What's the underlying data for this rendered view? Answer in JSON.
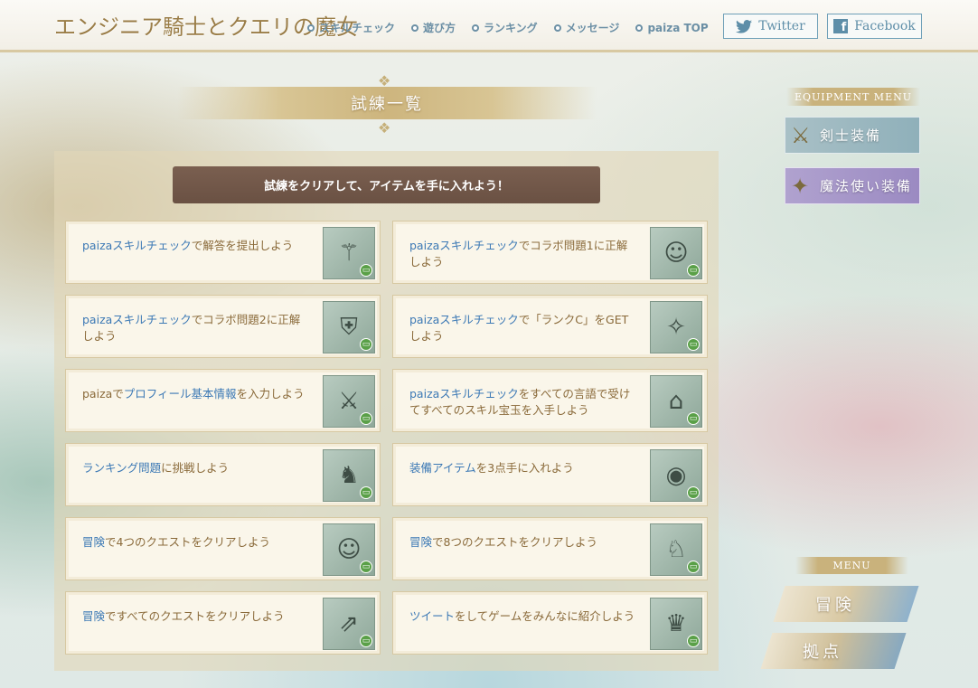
{
  "header": {
    "logo": "エンジニア騎士とクエリの魔女",
    "nav": [
      "スキルチェック",
      "遊び方",
      "ランキング",
      "メッセージ",
      "paiza TOP"
    ],
    "twitter_label": "Twitter",
    "facebook_label": "Facebook"
  },
  "page": {
    "title": "試練一覧",
    "subtitle": "試練をクリアして、アイテムを手に入れよう！"
  },
  "trials": [
    {
      "hl": "paizaスキルチェック",
      "text": "で解答を提出しよう",
      "icon": "broom-icon"
    },
    {
      "hl": "paizaスキルチェック",
      "text": "でコラボ問題1に正解しよう",
      "icon": "hair-icon"
    },
    {
      "hl": "paizaスキルチェック",
      "text": "でコラボ問題2に正解しよう",
      "icon": "shield-icon"
    },
    {
      "hl": "paizaスキルチェック",
      "text": "で「ランクC」をGETしよう",
      "icon": "staff-icon"
    },
    {
      "pre": "paizaで",
      "hl": "プロフィール基本情報",
      "text": "を入力しよう",
      "icon": "sword-icon"
    },
    {
      "hl": "paizaスキルチェック",
      "text": "をすべての言語で受けてすべてのスキル宝玉を入手しよう",
      "icon": "hat-icon"
    },
    {
      "hl": "ランキング問題",
      "text": "に挑戦しよう",
      "icon": "armor-icon"
    },
    {
      "hl": "装備アイテム",
      "text": "を3点手に入れよう",
      "icon": "round-shield-icon"
    },
    {
      "hl": "冒険",
      "text": "で4つのクエストをクリアしよう",
      "icon": "hair-icon"
    },
    {
      "hl": "冒険",
      "text": "で8つのクエストをクリアしよう",
      "icon": "knight-icon"
    },
    {
      "hl": "冒険",
      "text": "ですべてのクエストをクリアしよう",
      "icon": "spear-icon"
    },
    {
      "hl": "ツイート",
      "text": "をしてゲームをみんなに紹介しよう",
      "icon": "crown-icon"
    }
  ],
  "equipment_menu": {
    "label": "EQUIPMENT MENU",
    "swordsman": "剣士装備",
    "mage": "魔法使い装備"
  },
  "menu": {
    "label": "MENU",
    "adventure": "冒険",
    "base": "拠点"
  }
}
